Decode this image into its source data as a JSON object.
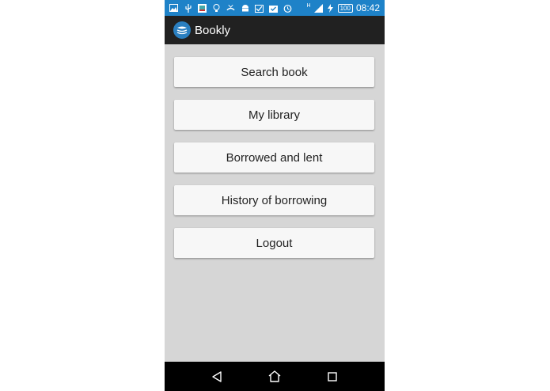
{
  "status_bar": {
    "icons": [
      "image-icon",
      "usb-icon",
      "photo-icon",
      "bulb-icon",
      "missed-call-icon",
      "android-icon",
      "photo-check-icon",
      "bag-check-icon",
      "alarm-icon",
      "signal-icon",
      "charging-icon"
    ],
    "network": "H",
    "battery": "100",
    "time": "08:42",
    "color": "#1e82c8"
  },
  "app_bar": {
    "title": "Bookly",
    "logo_icon": "books-stack-icon"
  },
  "menu": {
    "items": [
      {
        "label": "Search book"
      },
      {
        "label": "My library"
      },
      {
        "label": "Borrowed and lent"
      },
      {
        "label": "History of borrowing"
      },
      {
        "label": "Logout"
      }
    ]
  },
  "nav_bar": {
    "buttons": [
      "back-icon",
      "home-icon",
      "recents-icon"
    ]
  }
}
